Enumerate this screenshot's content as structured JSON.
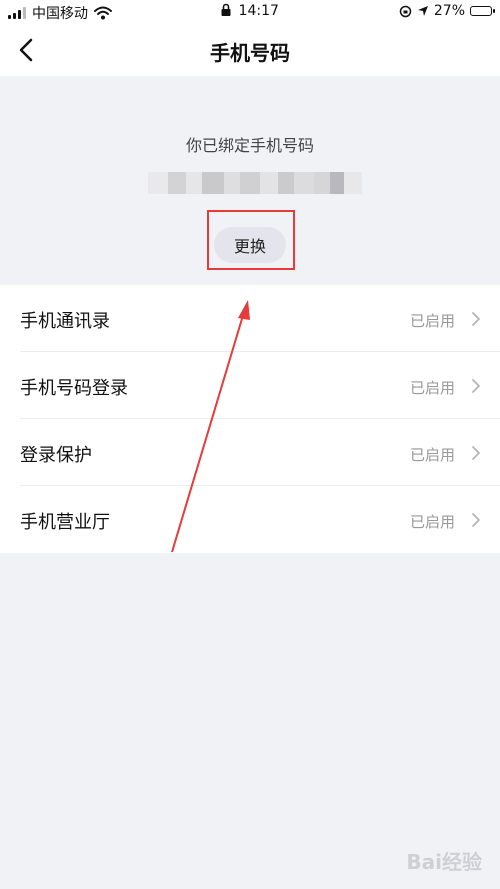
{
  "status_bar": {
    "carrier": "中国移动",
    "time": "14:17",
    "battery_percent": "27%",
    "battery_level": 0.27
  },
  "nav": {
    "title": "手机号码",
    "back_icon": "chevron-left-icon"
  },
  "phone": {
    "bound_label": "你已绑定手机号码",
    "change_button": "更换"
  },
  "settings": [
    {
      "label": "手机通讯录",
      "status": "已启用"
    },
    {
      "label": "手机号码登录",
      "status": "已启用"
    },
    {
      "label": "登录保护",
      "status": "已启用"
    },
    {
      "label": "手机营业厅",
      "status": "已启用"
    }
  ],
  "annotation": {
    "highlight_color": "#e83a3a"
  },
  "watermark": {
    "text": "Bai经验"
  }
}
